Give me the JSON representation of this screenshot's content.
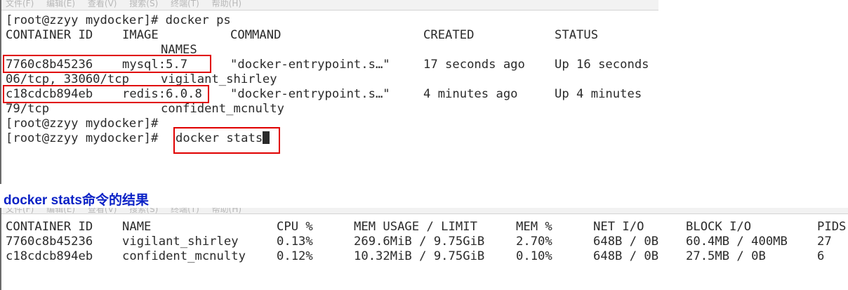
{
  "menu_items": [
    "文件(F)",
    "编辑(E)",
    "查看(V)",
    "搜索(S)",
    "终端(T)",
    "帮助(H)"
  ],
  "terminal_ps": {
    "prompt_command": "[root@zzyy mydocker]# docker ps",
    "header": {
      "container_id": "CONTAINER ID",
      "image": "IMAGE",
      "command": "COMMAND",
      "created": "CREATED",
      "status": "STATUS",
      "names": "NAMES"
    },
    "rows": [
      {
        "container_id": "7760c8b45236",
        "image": "mysql:5.7",
        "command": "\"docker-entrypoint.s…\"",
        "created": "17 seconds ago",
        "status": "Up 16 seconds",
        "ports_tail": "06/tcp, 33060/tcp",
        "names": "vigilant_shirley"
      },
      {
        "container_id": "c18cdcb894eb",
        "image": "redis:6.0.8",
        "command": "\"docker-entrypoint.s…\"",
        "created": "4 minutes ago",
        "status": "Up 4 minutes",
        "ports_tail": "79/tcp",
        "names": "confident_mcnulty"
      }
    ],
    "empty_prompt": "[root@zzyy mydocker]#",
    "current_prompt": "[root@zzyy mydocker]#",
    "current_input": "docker stats"
  },
  "caption": "docker stats命令的结果",
  "terminal_stats": {
    "header": {
      "container_id": "CONTAINER ID",
      "name": "NAME",
      "cpu": "CPU %",
      "mem_usage": "MEM USAGE / LIMIT",
      "mem_pct": "MEM %",
      "net_io": "NET I/O",
      "block_io": "BLOCK I/O",
      "pids": "PIDS"
    },
    "rows": [
      {
        "container_id": "7760c8b45236",
        "name": "vigilant_shirley",
        "cpu": "0.13%",
        "mem_usage": "269.6MiB / 9.75GiB",
        "mem_pct": "2.70%",
        "net_io": "648B / 0B",
        "block_io": "60.4MB / 400MB",
        "pids": "27"
      },
      {
        "container_id": "c18cdcb894eb",
        "name": "confident_mcnulty",
        "cpu": "0.12%",
        "mem_usage": "10.32MiB / 9.75GiB",
        "mem_pct": "0.10%",
        "net_io": "648B / 0B",
        "block_io": "27.5MB / 0B",
        "pids": "6"
      }
    ]
  },
  "colors": {
    "highlight": "#e00000",
    "caption": "#0b22c6",
    "terminal_text": "#2b2b2b"
  }
}
